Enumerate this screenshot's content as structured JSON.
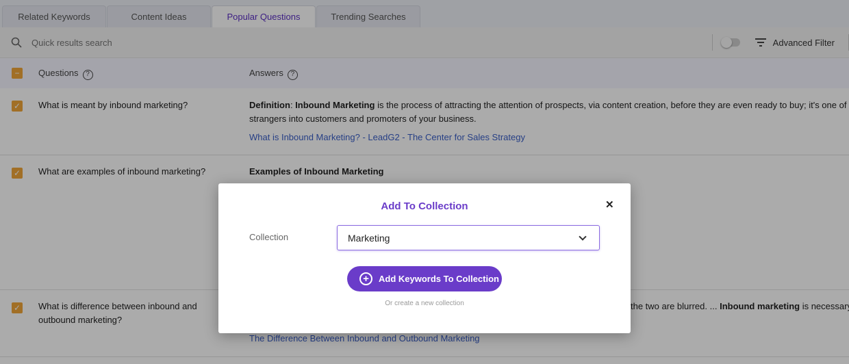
{
  "tabs": [
    {
      "label": "Related Keywords"
    },
    {
      "label": "Content Ideas"
    },
    {
      "label": "Popular Questions",
      "active": true
    },
    {
      "label": "Trending Searches"
    }
  ],
  "search": {
    "placeholder": "Quick results search"
  },
  "toolbar": {
    "advanced_filter": "Advanced Filter"
  },
  "table": {
    "headers": {
      "questions": "Questions",
      "answers": "Answers"
    },
    "rows": [
      {
        "question": "What is meant by inbound marketing?",
        "answer_bold1": "Definition",
        "answer_sep": ": ",
        "answer_bold2": "Inbound Marketing",
        "answer_text": " is the process of attracting the attention of prospects, via content creation, before they are even ready to buy; it's one of t",
        "answer_text2": "strangers into customers and promoters of your business.",
        "link": "What is Inbound Marketing? - LeadG2 - The Center for Sales Strategy"
      },
      {
        "question": "What are examples of inbound marketing?",
        "answer_heading": "Examples of Inbound Marketing"
      },
      {
        "question": "What is difference between inbound and outbound marketing?",
        "answer_text": "the two are blurred. ... ",
        "answer_bold": "Inbound marketing",
        "answer_text_end": " is necessary",
        "link": "The Difference Between Inbound and Outbound Marketing"
      }
    ]
  },
  "modal": {
    "title": "Add To Collection",
    "collection_label": "Collection",
    "collection_value": "Marketing",
    "add_button": "Add Keywords To Collection",
    "create_link": "Or create a new collection"
  },
  "colors": {
    "accent": "#6a3cc9",
    "checkbox": "#f0a63a",
    "link": "#3a5ec7"
  }
}
